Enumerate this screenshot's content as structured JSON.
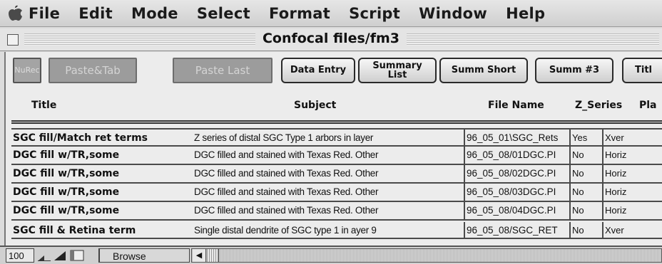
{
  "menubar": {
    "apple_icon": "apple-logo-icon",
    "items": [
      "File",
      "Edit",
      "Mode",
      "Select",
      "Format",
      "Script",
      "Window",
      "Help"
    ]
  },
  "window": {
    "title": "Confocal files/fm3"
  },
  "toolbar": {
    "buttons": [
      {
        "label": "NuRec"
      },
      {
        "label": "Paste&Tab"
      },
      {
        "label": "Paste Last"
      },
      {
        "label": "Data Entry"
      },
      {
        "line1": "Summary",
        "line2": "List"
      },
      {
        "label": "Summ Short"
      },
      {
        "label": "Summ #3"
      },
      {
        "label": "Titl"
      }
    ]
  },
  "columns": [
    "Title",
    "Subject",
    "File Name",
    "Z_Series",
    "Pla"
  ],
  "rows": [
    {
      "title": "SGC fill/Match ret terms",
      "subject": "Z series of distal SGC Type 1 arbors in layer",
      "file": "96_05_01\\SGC_Rets",
      "z": "Yes",
      "pl": "Xver"
    },
    {
      "title": "DGC fill w/TR,some",
      "subject": "DGC filled and stained with Texas Red. Other",
      "file": "96_05_08/01DGC.PI",
      "z": "No",
      "pl": "Horiz"
    },
    {
      "title": "DGC fill w/TR,some",
      "subject": "DGC filled and stained with Texas Red. Other",
      "file": "96_05_08/02DGC.PI",
      "z": "No",
      "pl": "Horiz"
    },
    {
      "title": "DGC fill w/TR,some",
      "subject": "DGC filled and stained with Texas Red. Other",
      "file": "96_05_08/03DGC.PI",
      "z": "No",
      "pl": "Horiz"
    },
    {
      "title": "DGC fill w/TR,some",
      "subject": "DGC filled and stained with Texas Red. Other",
      "file": "96_05_08/04DGC.PI",
      "z": "No",
      "pl": "Horiz"
    },
    {
      "title": "SGC fill & Retina term",
      "subject": "Single distal dendrite of SGC type 1 in ayer 9",
      "file": "96_05_08/SGC_RET",
      "z": "No",
      "pl": "Xver"
    }
  ],
  "statusbar": {
    "zoom": "100",
    "mode": "Browse"
  }
}
